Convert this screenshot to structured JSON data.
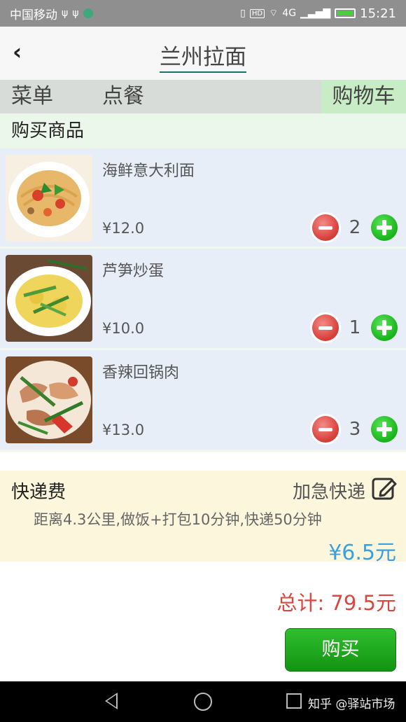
{
  "status_bar": {
    "carrier": "中国移动",
    "network": "4G",
    "time": "15:21",
    "hd_label": "HD"
  },
  "header": {
    "back_icon": "chevron-left-icon",
    "title": "兰州拉面"
  },
  "tabs": [
    {
      "label": "菜单"
    },
    {
      "label": "点餐"
    },
    {
      "label": "购物车"
    }
  ],
  "section_title": "购买商品",
  "items": [
    {
      "name": "海鲜意大利面",
      "price": "¥12.0",
      "quantity": "2"
    },
    {
      "name": "芦笋炒蛋",
      "price": "¥10.0",
      "quantity": "1"
    },
    {
      "name": "香辣回锅肉",
      "price": "¥13.0",
      "quantity": "3"
    }
  ],
  "delivery": {
    "label": "快递费",
    "express_label": "加急快递",
    "description": "距离4.3公里,做饭+打包10分钟,快递50分钟",
    "fee": "¥6.5元"
  },
  "total_label": "总计: 79.5元",
  "buy_label": "购买",
  "watermark": "知乎 @驿站市场",
  "colors": {
    "status_bar": "#8f8f8f",
    "active_tab": "#c8edc6",
    "item_bg": "#e7eef7",
    "delivery_bg": "#fbf6dc",
    "fee": "#3aa0e0",
    "total": "#d9473f",
    "buy_button": "#1fa51f"
  }
}
